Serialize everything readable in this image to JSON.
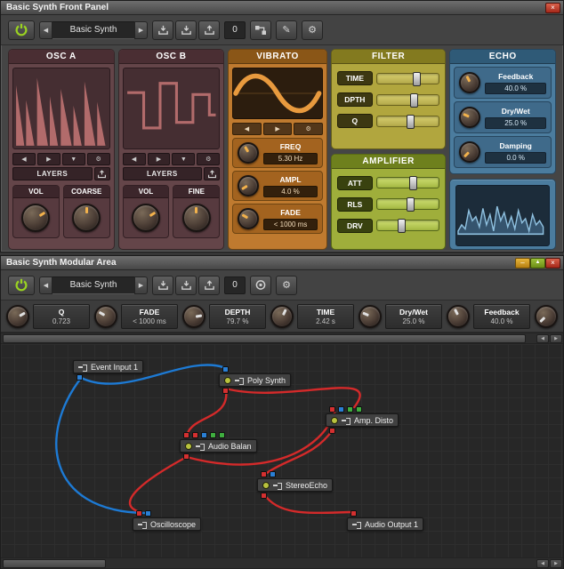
{
  "colors": {
    "cable-red": "#d42a2a",
    "cable-blue": "#1d7ad4",
    "port-red": "#d43030",
    "port-blue": "#2a7fd4",
    "port-green": "#3fae3f",
    "power-green": "#9ad321",
    "wave-osc": "#b26b6b",
    "wave-vib": "#e89a3e",
    "wave-echo": "#8fc1e0"
  },
  "icons": {
    "close": "×",
    "minimize": "–",
    "maximize": "▲",
    "prev": "◀",
    "next": "▶",
    "down": "▼",
    "gear": "⚙",
    "pencil": "✎"
  },
  "front": {
    "title": "Basic Synth Front Panel",
    "toolbar": {
      "preset": "Basic Synth",
      "count": "0"
    },
    "osc_a": {
      "title": "OSC A",
      "layers": "LAYERS",
      "knobs": [
        {
          "label": "VOL"
        },
        {
          "label": "COARSE"
        }
      ]
    },
    "osc_b": {
      "title": "OSC B",
      "layers": "LAYERS",
      "knobs": [
        {
          "label": "VOL"
        },
        {
          "label": "FINE"
        }
      ]
    },
    "vibrato": {
      "title": "VIBRATO",
      "knobs": [
        {
          "label": "FREQ",
          "value": "5.30 Hz"
        },
        {
          "label": "AMPL",
          "value": "4.0 %"
        },
        {
          "label": "FADE",
          "value": "< 1000 ms"
        }
      ]
    },
    "filter": {
      "title": "FILTER",
      "sliders": [
        {
          "label": "TIME"
        },
        {
          "label": "DPTH"
        },
        {
          "label": "Q"
        }
      ]
    },
    "amplifier": {
      "title": "AMPLIFIER",
      "sliders": [
        {
          "label": "ATT"
        },
        {
          "label": "RLS"
        },
        {
          "label": "DRV"
        }
      ]
    },
    "echo": {
      "title": "ECHO",
      "knobs": [
        {
          "label": "Feedback",
          "value": "40.0 %"
        },
        {
          "label": "Dry/Wet",
          "value": "25.0 %"
        },
        {
          "label": "Damping",
          "value": "0.0 %"
        }
      ]
    }
  },
  "modular": {
    "title": "Basic Synth Modular Area",
    "toolbar": {
      "preset": "Basic Synth",
      "count": "0"
    },
    "params": [
      {
        "label": "Q",
        "value": "0.723"
      },
      {
        "label": "FADE",
        "value": "< 1000 ms"
      },
      {
        "label": "DEPTH",
        "value": "79.7 %"
      },
      {
        "label": "TIME",
        "value": "2.42 s"
      },
      {
        "label": "Dry/Wet",
        "value": "25.0 %"
      },
      {
        "label": "Feedback",
        "value": "40.0 %"
      }
    ],
    "modules": [
      {
        "label": "Event Input 1"
      },
      {
        "label": "Poly Synth"
      },
      {
        "label": "Amp. Disto"
      },
      {
        "label": "Audio Balan"
      },
      {
        "label": "StereoEcho"
      },
      {
        "label": "Oscilloscope"
      },
      {
        "label": "Audio Output 1"
      }
    ]
  }
}
